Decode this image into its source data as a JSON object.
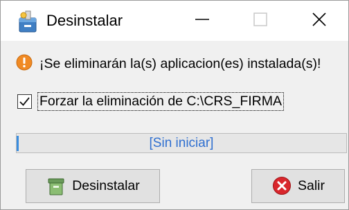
{
  "window": {
    "title": "Desinstalar",
    "app_icon": "installer-package-icon",
    "controls": {
      "minimize": "minimize-icon",
      "maximize": "maximize-icon",
      "close": "close-icon"
    }
  },
  "message": {
    "icon": "warning-icon",
    "text": "¡Se eliminarán la(s) aplicacion(es) instalada(s)!"
  },
  "force_option": {
    "label": "Forzar la eliminación de C:\\CRS_FIRMA",
    "checked": true
  },
  "progress": {
    "status_text": "[Sin iniciar]",
    "value_percent": 0
  },
  "buttons": {
    "uninstall_label": "Desinstalar",
    "uninstall_icon": "trash-bin-icon",
    "exit_label": "Salir",
    "exit_icon": "cancel-icon"
  },
  "colors": {
    "warning": "#f08a24",
    "cancel": "#d9262c",
    "progress_text": "#2f6fd0",
    "window_bg": "#f0f0f0"
  }
}
